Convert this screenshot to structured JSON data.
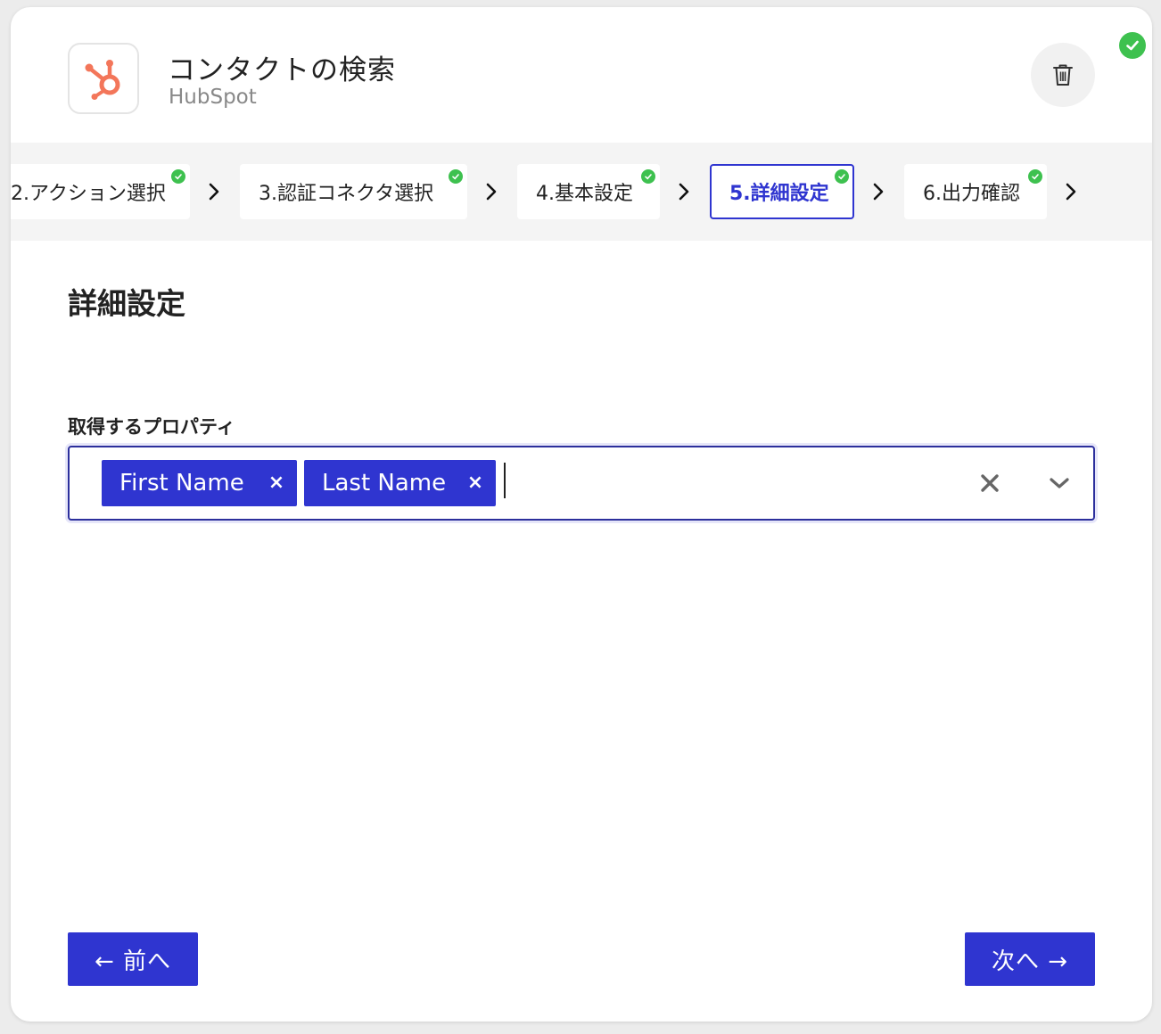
{
  "header": {
    "title": "コンタクトの検索",
    "subtitle": "HubSpot",
    "app_icon": "hubspot-logo",
    "brand_color": "#f3765a",
    "delete_icon": "trash-icon",
    "status_icon": "check-circle-icon"
  },
  "steps": [
    {
      "label": "2.アクション選択",
      "completed": true,
      "active": false
    },
    {
      "label": "3.認証コネクタ選択",
      "completed": true,
      "active": false
    },
    {
      "label": "4.基本設定",
      "completed": true,
      "active": false
    },
    {
      "label": "5.詳細設定",
      "completed": true,
      "active": true
    },
    {
      "label": "6.出力確認",
      "completed": true,
      "active": false
    }
  ],
  "section": {
    "heading": "詳細設定"
  },
  "properties_field": {
    "label": "取得するプロパティ",
    "selected": [
      {
        "label": "First Name",
        "remove": "×"
      },
      {
        "label": "Last Name",
        "remove": "×"
      }
    ],
    "input_value": ""
  },
  "footer": {
    "prev_label": "← 前へ",
    "next_label": "次へ →"
  },
  "colors": {
    "accent": "#2f35d0",
    "success": "#3ec14f",
    "step_bar_bg": "#f4f4f4"
  }
}
